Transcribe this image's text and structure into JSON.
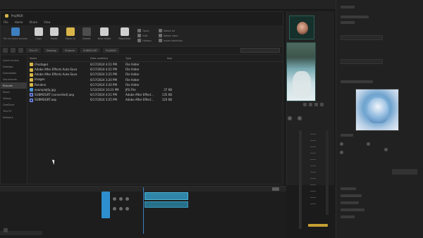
{
  "explorer": {
    "title": "ProjMGR",
    "menu": [
      "File",
      "Home",
      "Share",
      "View"
    ],
    "ribbon": {
      "groups": [
        {
          "label": "Pin to Quick access",
          "icon": "pin-icon"
        },
        {
          "label": "Copy",
          "icon": "copy-icon"
        },
        {
          "label": "Paste",
          "icon": "paste-icon"
        },
        {
          "label": "Move to",
          "icon": "folder-move-icon"
        },
        {
          "label": "Delete",
          "icon": "delete-icon"
        },
        {
          "label": "New folder",
          "icon": "new-folder-icon"
        },
        {
          "label": "Properties",
          "icon": "properties-icon"
        }
      ],
      "open_items": [
        "Open",
        "Edit",
        "History"
      ],
      "select_items": [
        "Select all",
        "Select none",
        "Invert selection"
      ]
    },
    "breadcrumbs": [
      "This PC",
      "Desktop",
      "Projects",
      "SUBMOGRT",
      "ProjMGR"
    ],
    "nav_items": [
      "Quick access",
      "Desktop",
      "Downloads",
      "Documents",
      "Pictures",
      "Music",
      "Videos",
      "OneDrive",
      "This PC",
      "Network"
    ],
    "columns": {
      "name": "Name",
      "date": "Date modified",
      "type": "Type",
      "size": "Size"
    },
    "files": [
      {
        "kind": "folder",
        "name": "(Footage)",
        "date": "6/17/2024 4:21 PM",
        "type": "File folder",
        "size": ""
      },
      {
        "kind": "folder",
        "name": "Adobe After Effects Auto-Save",
        "date": "6/17/2024 4:21 PM",
        "type": "File folder",
        "size": ""
      },
      {
        "kind": "folder",
        "name": "Adobe After Effects Auto-Save",
        "date": "6/17/2024 3:25 PM",
        "type": "File folder",
        "size": ""
      },
      {
        "kind": "folder",
        "name": "Images",
        "date": "6/17/2024 3:20 PM",
        "type": "File folder",
        "size": ""
      },
      {
        "kind": "folder",
        "name": "Renders",
        "date": "6/17/2024 3:20 PM",
        "type": "File folder",
        "size": ""
      },
      {
        "kind": "jpg",
        "name": "examplejfp.jpg",
        "date": "5/12/2024 10:23 PM",
        "type": "JPG File",
        "size": "37 KB"
      },
      {
        "kind": "aep",
        "name": "SUBMOGRT (converted).aep",
        "date": "6/17/2024 4:21 PM",
        "type": "Adobe After Effect...",
        "size": "135 KB"
      },
      {
        "kind": "aep",
        "name": "SUBMOGRT.aep",
        "date": "6/17/2024 3:25 PM",
        "type": "Adobe After Effect...",
        "size": "120 KB"
      }
    ]
  },
  "colors": {
    "accent": "#2e8fd0",
    "clip": "#2f86a8",
    "marker": "#c6a032"
  }
}
